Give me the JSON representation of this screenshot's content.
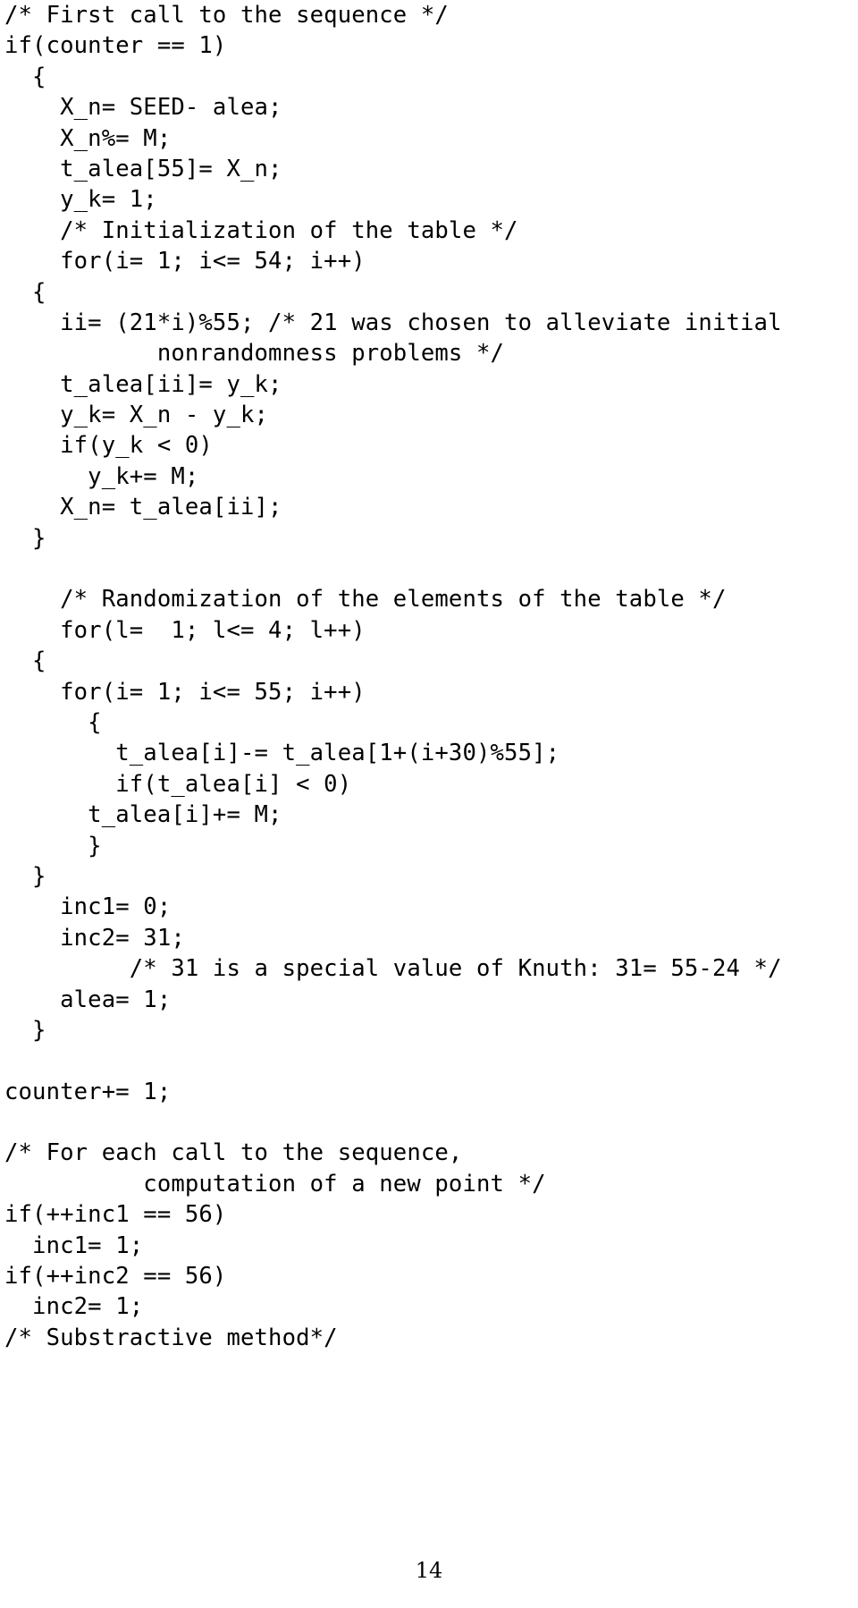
{
  "document": {
    "page_number": "14",
    "content_type": "c-source-code-listing",
    "lines": [
      "/* First call to the sequence */",
      "if(counter == 1)",
      "  {",
      "    X_n= SEED- alea;",
      "    X_n%= M;",
      "    t_alea[55]= X_n;",
      "    y_k= 1;",
      "    /* Initialization of the table */",
      "    for(i= 1; i<= 54; i++)",
      "  {",
      "    ii= (21*i)%55; /* 21 was chosen to alleviate initial",
      "           nonrandomness problems */",
      "    t_alea[ii]= y_k;",
      "    y_k= X_n - y_k;",
      "    if(y_k < 0)",
      "      y_k+= M;",
      "    X_n= t_alea[ii];",
      "  }",
      "",
      "    /* Randomization of the elements of the table */",
      "    for(l=  1; l<= 4; l++)",
      "  {",
      "    for(i= 1; i<= 55; i++)",
      "      {",
      "        t_alea[i]-= t_alea[1+(i+30)%55];",
      "        if(t_alea[i] < 0)",
      "      t_alea[i]+= M;",
      "      }",
      "  }",
      "    inc1= 0;",
      "    inc2= 31;",
      "         /* 31 is a special value of Knuth: 31= 55-24 */",
      "    alea= 1;",
      "  }",
      "",
      "counter+= 1;",
      "",
      "/* For each call to the sequence,",
      "          computation of a new point */",
      "if(++inc1 == 56)",
      "  inc1= 1;",
      "if(++inc2 == 56)",
      "  inc2= 1;",
      "/* Substractive method*/"
    ]
  }
}
